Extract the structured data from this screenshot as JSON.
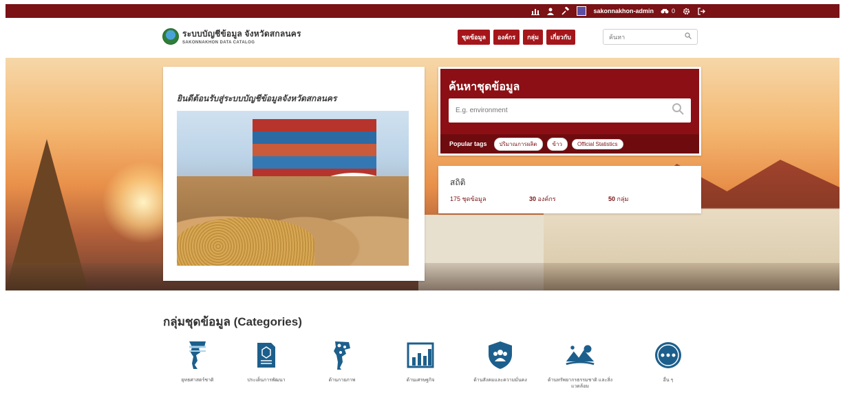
{
  "account_bar": {
    "username": "sakonnakhon-admin",
    "activity_count": "0",
    "icons": [
      "dashboard-icon",
      "user-icon",
      "gavel-icon",
      "avatar",
      "activity-icon",
      "settings-icon",
      "logout-icon"
    ]
  },
  "header": {
    "logo_title": "ระบบบัญชีข้อมูล จังหวัดสกลนคร",
    "logo_subtitle": "SAKONNAKHON DATA CATALOG",
    "nav": [
      "ชุดข้อมูล",
      "องค์กร",
      "กลุ่ม",
      "เกี่ยวกับ"
    ],
    "search_placeholder": "ค้นหา"
  },
  "hero": {
    "welcome_title": "ยินดีต้อนรับสู่ระบบบัญชีข้อมูลจังหวัดสกลนคร",
    "search_title": "ค้นหาชุดข้อมูล",
    "search_placeholder": "E.g. environment",
    "popular_tags_label": "Popular tags",
    "tags": [
      "ปริมาณการผลิต",
      "ข้าว",
      "Official Statistics"
    ],
    "stats_title": "สถิติ",
    "stats": [
      {
        "value": "175",
        "label": "ชุดข้อมูล"
      },
      {
        "value": "30",
        "label": "องค์กร"
      },
      {
        "value": "50",
        "label": "กลุ่ม"
      }
    ]
  },
  "categories": {
    "title": "กลุ่มชุดข้อมูล (Categories)",
    "items": [
      {
        "label": "ยุทธศาสตร์ชาติ",
        "icon": "thailand-map-icon"
      },
      {
        "label": "ประเด็นการพัฒนา",
        "icon": "document-icon"
      },
      {
        "label": "ด้านกายภาพ",
        "icon": "map-pin-icon"
      },
      {
        "label": "ด้านเศรษฐกิจ",
        "icon": "bar-chart-icon"
      },
      {
        "label": "ด้านสังคมและความมั่นคง",
        "icon": "people-shield-icon"
      },
      {
        "label": "ด้านทรัพยากรธรรมชาติ และสิ่งแวดล้อม",
        "icon": "nature-icon"
      },
      {
        "label": "อื่น ๆ",
        "icon": "more-icon"
      }
    ]
  },
  "colors": {
    "brand": "#7a1216",
    "nav_button": "#a5161b",
    "search_card": "#8b0f14",
    "category_icon": "#1d5f8c"
  }
}
